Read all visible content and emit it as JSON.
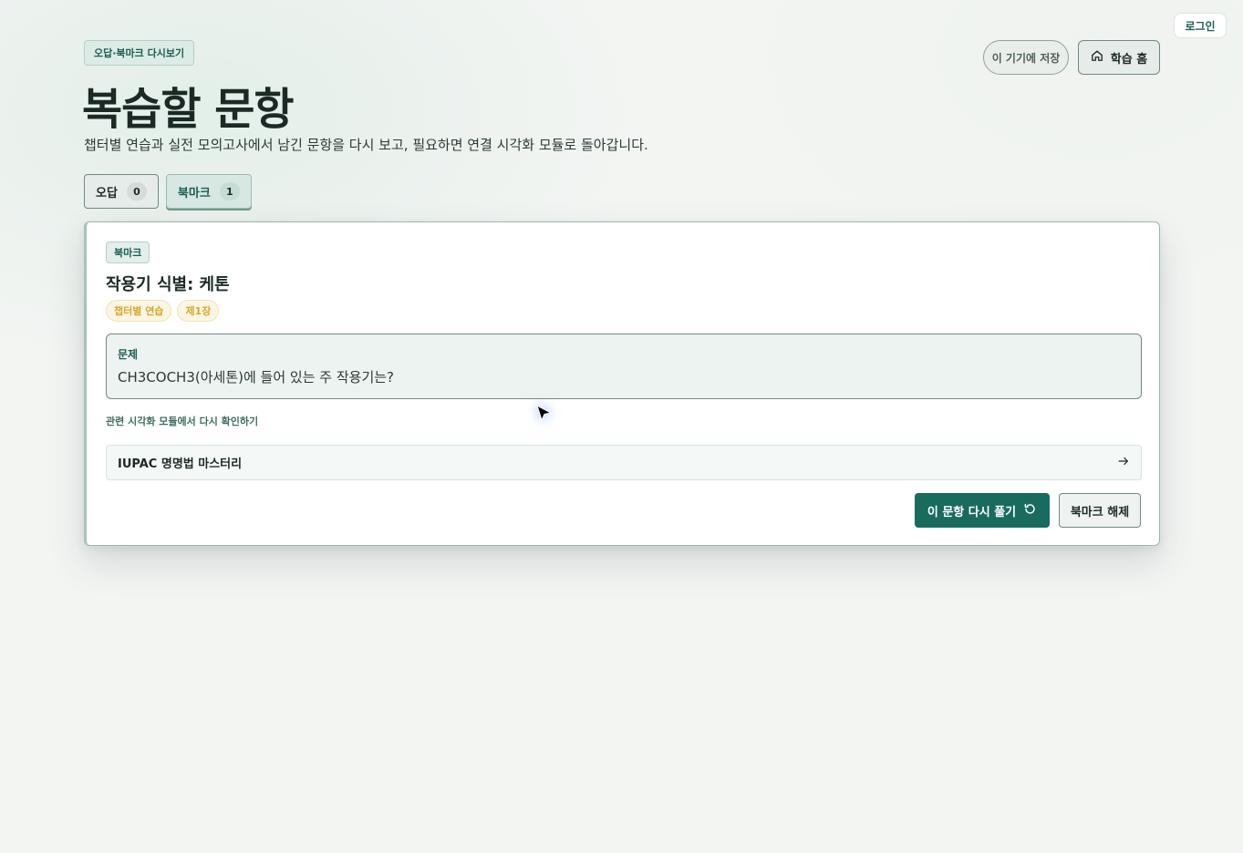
{
  "header": {
    "login_label": "로그인",
    "save_device_label": "이 기기에 저장",
    "home_label": "학습 홈",
    "eyebrow": "오답·북마크 다시보기",
    "title": "복습할 문항",
    "subtitle": "챕터별 연습과 실전 모의고사에서 남긴 문항을 다시 보고, 필요하면 연결 시각화 모듈로 돌아갑니다."
  },
  "tabs": [
    {
      "label": "오답",
      "count": "0",
      "active": false
    },
    {
      "label": "북마크",
      "count": "1",
      "active": true
    }
  ],
  "card": {
    "badge": "북마크",
    "title": "작용기 식별: 케톤",
    "tags": [
      "챕터별 연습",
      "제1장"
    ],
    "question_label": "문제",
    "question_text": "CH3COCH3(아세톤)에 들어 있는 주 작용기는?",
    "related_label": "관련 시각화 모듈에서 다시 확인하기",
    "module_name": "IUPAC 명명법 마스터리",
    "retry_label": "이 문항 다시 풀기",
    "unbookmark_label": "북마크 해제"
  },
  "colors": {
    "accent": "#196b5e",
    "tag_text": "#d6a92d",
    "background": "#f3f5f3"
  },
  "icons": [
    "home-icon",
    "arrow-right-icon",
    "refresh-icon",
    "cursor-icon"
  ]
}
